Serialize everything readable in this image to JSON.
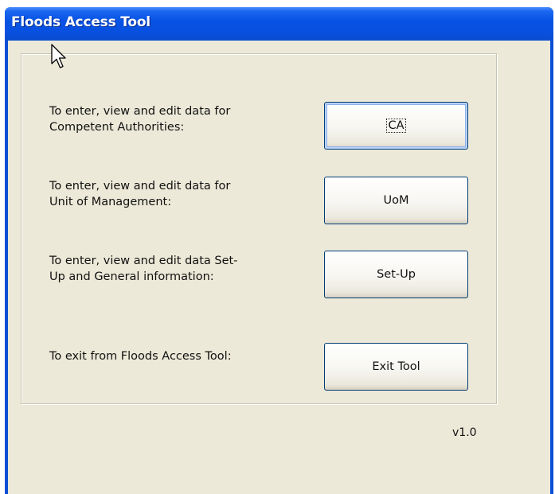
{
  "window": {
    "title": "Floods Access Tool"
  },
  "rows": [
    {
      "description_line1": "To enter, view and edit data for",
      "description_line2": "Competent Authorities:",
      "button_label": "CA"
    },
    {
      "description_line1": "To enter, view and edit data for",
      "description_line2": "Unit of Management:",
      "button_label": "UoM"
    },
    {
      "description_line1": "To enter, view and edit data Set-",
      "description_line2": "Up and General information:",
      "button_label": "Set-Up"
    },
    {
      "description_line1": "To exit from Floods Access Tool:",
      "description_line2": "",
      "button_label": "Exit Tool"
    }
  ],
  "version": "v1.0",
  "icons": {
    "cursor": "mouse-pointer-icon"
  },
  "colors": {
    "titlebar": "#0853e4",
    "client_background": "#ece9d8",
    "button_border": "#003c74"
  }
}
